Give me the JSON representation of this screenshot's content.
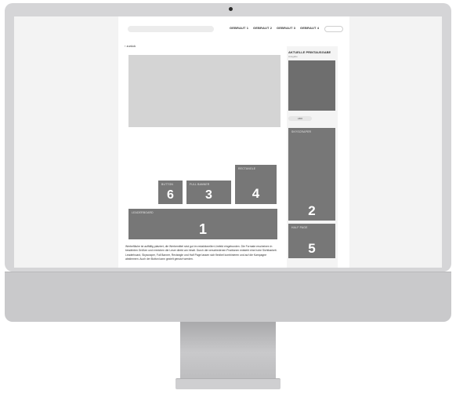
{
  "website": {
    "nav": {
      "links": [
        "GEBRAUT 1",
        "GEBRAUT 2",
        "GEBRAUT 3",
        "GEBRAUT 4"
      ]
    },
    "back_link": "‹ zurück",
    "boxes": [
      {
        "id": "leaderboard",
        "label": "LEADERBOARD",
        "number": "1"
      },
      {
        "id": "skyscraper",
        "label": "SKYSCRAPER",
        "number": "2"
      },
      {
        "id": "full-banner",
        "label": "FULL BANNER",
        "number": "3"
      },
      {
        "id": "rectangle",
        "label": "RECTANGLE",
        "number": "4"
      },
      {
        "id": "half-page",
        "label": "HALF PAGE",
        "number": "5"
      },
      {
        "id": "button",
        "label": "BUTTON",
        "number": "6"
      }
    ],
    "article_text": "Werbefläche ist auffällig platziert, die Werbemittel sind gut im redaktionellen Umfeld eingebunden. Die Formate erscheinen in bewährten Größen und erreichen die Leser direkt am Inhalt. Durch die verschiedenen Positionen entsteht eine hohe Sichtbarkeit. Leaderboard, Skyscraper, Full Banner, Rectangle und Half Page lassen sich flexibel kombinieren und auf die Kampagne abstimmen. Auch der Button kann gezielt genutzt werden.",
    "sidebar": {
      "title": "AKTUELLE PRINTAUSGABE",
      "subtitle": "Ausgabe",
      "pill": "ABO"
    }
  }
}
